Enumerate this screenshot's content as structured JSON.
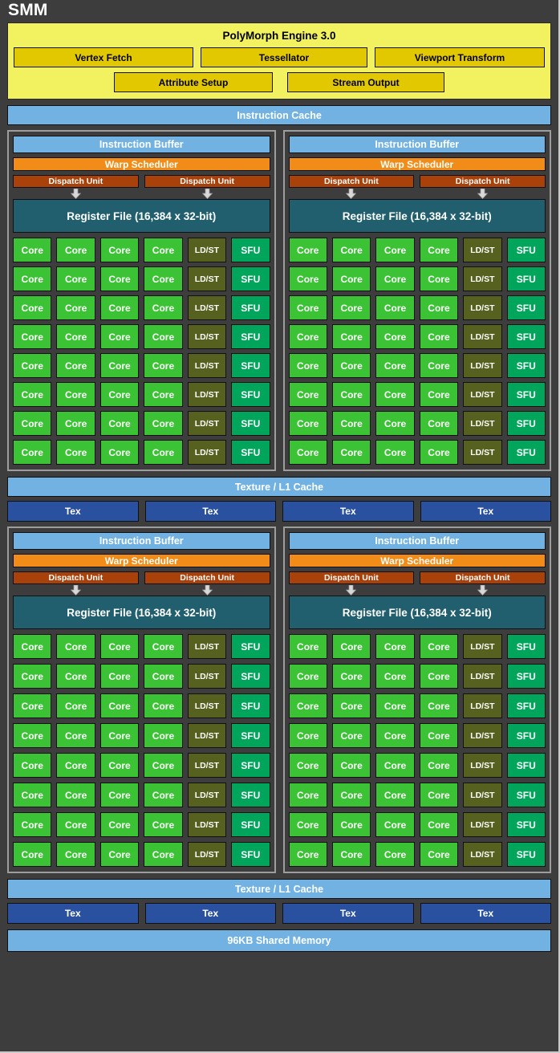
{
  "title": "SMM",
  "polymorph": {
    "title": "PolyMorph Engine 3.0",
    "row1": [
      "Vertex Fetch",
      "Tessellator",
      "Viewport Transform"
    ],
    "row2": [
      "Attribute Setup",
      "Stream Output"
    ]
  },
  "instruction_cache": "Instruction Cache",
  "texture_l1_cache": "Texture / L1 Cache",
  "shared_memory": "96KB Shared Memory",
  "tex_label": "Tex",
  "tex_count_per_row": 4,
  "processing_block": {
    "instruction_buffer": "Instruction Buffer",
    "warp_scheduler": "Warp Scheduler",
    "dispatch_unit": "Dispatch Unit",
    "dispatch_unit_count": 2,
    "register_file": "Register File (16,384 x 32-bit)",
    "core_rows": 8,
    "cores_per_row": 4,
    "labels": {
      "core": "Core",
      "ldst": "LD/ST",
      "sfu": "SFU"
    }
  },
  "colors": {
    "background": "#3d3d3d",
    "polymorph_bg": "#f2f261",
    "polymorph_btn": "#e2c800",
    "cache_blue": "#71b2e2",
    "tex_blue": "#2a51a0",
    "warp_orange": "#f28c18",
    "dispatch_brown": "#a8410a",
    "register_teal": "#215f6e",
    "core_green": "#3bc335",
    "ldst_olive": "#56601f",
    "sfu_green": "#00a55c",
    "text_light": "#ffffff",
    "text_dark": "#000000"
  }
}
